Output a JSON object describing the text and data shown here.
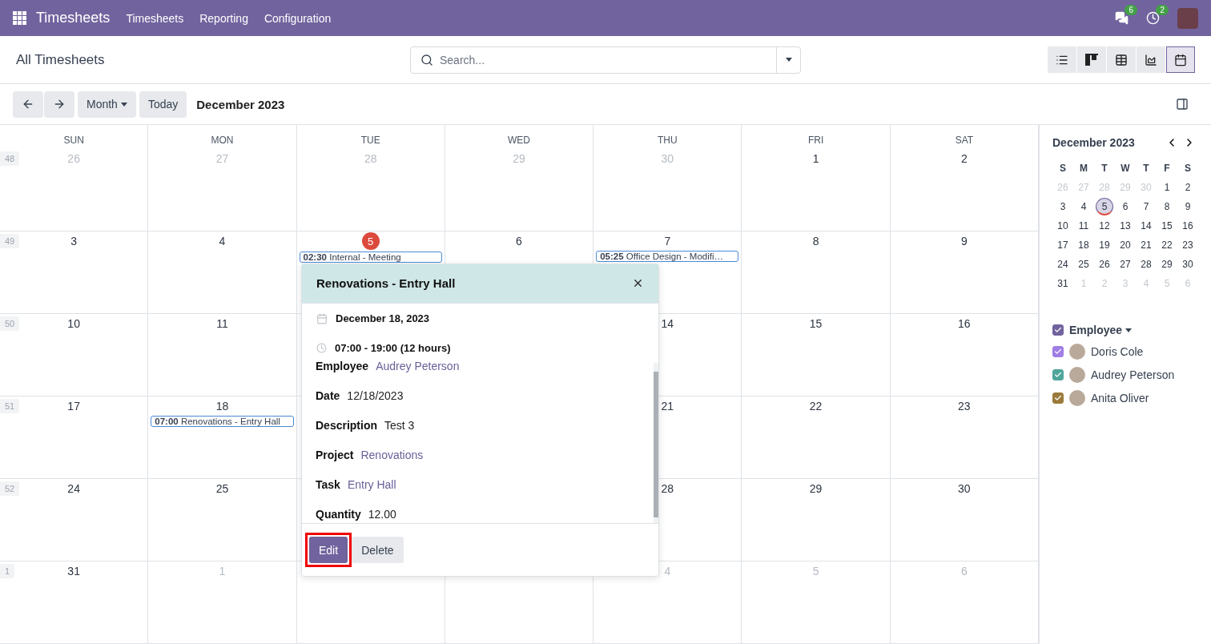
{
  "navbar": {
    "app_name": "Timesheets",
    "menu": [
      "Timesheets",
      "Reporting",
      "Configuration"
    ],
    "messages_count": "6",
    "activities_count": "2"
  },
  "control_panel": {
    "breadcrumb": "All Timesheets",
    "search": {
      "placeholder": "Search..."
    },
    "views": [
      {
        "kind": "list",
        "selected": false
      },
      {
        "kind": "kanban",
        "selected": false
      },
      {
        "kind": "pivot",
        "selected": false
      },
      {
        "kind": "graph",
        "selected": false
      },
      {
        "kind": "calendar",
        "selected": true
      }
    ]
  },
  "toolbar": {
    "scale": "Month",
    "today": "Today",
    "period": "December 2023"
  },
  "calendar": {
    "weekdays": [
      "SUN",
      "MON",
      "TUE",
      "WED",
      "THU",
      "FRI",
      "SAT"
    ],
    "weeks": [
      {
        "week": "48",
        "days": [
          {
            "day": "26",
            "other_month": true,
            "today": false
          },
          {
            "day": "27",
            "other_month": true,
            "today": false
          },
          {
            "day": "28",
            "other_month": true,
            "today": false
          },
          {
            "day": "29",
            "other_month": true,
            "today": false
          },
          {
            "day": "30",
            "other_month": true,
            "today": false
          },
          {
            "day": "1",
            "other_month": false,
            "today": false
          },
          {
            "day": "2",
            "other_month": false,
            "today": false
          }
        ]
      },
      {
        "week": "49",
        "days": [
          {
            "day": "3",
            "other_month": false,
            "today": false
          },
          {
            "day": "4",
            "other_month": false,
            "today": false
          },
          {
            "day": "5",
            "other_month": false,
            "today": true,
            "events": [
              {
                "time": "02:30",
                "title": "Internal - Meeting"
              }
            ]
          },
          {
            "day": "6",
            "other_month": false,
            "today": false
          },
          {
            "day": "7",
            "other_month": false,
            "today": false,
            "events": [
              {
                "time": "05:25",
                "title": "Office Design - Modifi…"
              }
            ]
          },
          {
            "day": "8",
            "other_month": false,
            "today": false
          },
          {
            "day": "9",
            "other_month": false,
            "today": false
          }
        ]
      },
      {
        "week": "50",
        "days": [
          {
            "day": "10",
            "other_month": false,
            "today": false
          },
          {
            "day": "11",
            "other_month": false,
            "today": false
          }
        ],
        "trailing_days": [
          {
            "day": "14",
            "other_month": false,
            "today": false
          },
          {
            "day": "15",
            "other_month": false,
            "today": false
          },
          {
            "day": "16",
            "other_month": false,
            "today": false
          }
        ]
      },
      {
        "week": "51",
        "days": [
          {
            "day": "17",
            "other_month": false,
            "today": false
          },
          {
            "day": "18",
            "other_month": false,
            "today": false,
            "events": [
              {
                "time": "07:00",
                "title": "Renovations - Entry Hall"
              }
            ]
          }
        ],
        "trailing_days": [
          {
            "day": "21",
            "other_month": false,
            "today": false
          },
          {
            "day": "22",
            "other_month": false,
            "today": false
          },
          {
            "day": "23",
            "other_month": false,
            "today": false
          }
        ]
      },
      {
        "week": "52",
        "days": [
          {
            "day": "24",
            "other_month": false,
            "today": false
          },
          {
            "day": "25",
            "other_month": false,
            "today": false
          }
        ],
        "trailing_days": [
          {
            "day": "28",
            "other_month": false,
            "today": false
          },
          {
            "day": "29",
            "other_month": false,
            "today": false
          },
          {
            "day": "30",
            "other_month": false,
            "today": false
          }
        ]
      },
      {
        "week": "1",
        "days": [
          {
            "day": "31",
            "other_month": false,
            "today": false
          },
          {
            "day": "1",
            "other_month": true,
            "today": false
          }
        ],
        "trailing_days": [
          {
            "day": "4",
            "other_month": true,
            "today": false
          },
          {
            "day": "5",
            "other_month": true,
            "today": false
          },
          {
            "day": "6",
            "other_month": true,
            "today": false
          }
        ]
      }
    ]
  },
  "popover": {
    "title": "Renovations - Entry Hall",
    "date": "December 18, 2023",
    "time": "07:00 - 19:00 (12 hours)",
    "fields": [
      {
        "label": "Employee",
        "value": "Audrey Peterson",
        "kind": "link"
      },
      {
        "label": "Date",
        "value": "12/18/2023",
        "kind": "text"
      },
      {
        "label": "Description",
        "value": "Test 3",
        "kind": "text"
      },
      {
        "label": "Project",
        "value": "Renovations",
        "kind": "link"
      },
      {
        "label": "Task",
        "value": "Entry Hall",
        "kind": "link"
      },
      {
        "label": "Quantity",
        "value": "12.00",
        "kind": "text"
      }
    ],
    "buttons": [
      {
        "label": "Edit",
        "kind": "primary",
        "highlighted": true
      },
      {
        "label": "Delete",
        "kind": "secondary",
        "highlighted": false
      }
    ]
  },
  "sidebar": {
    "mini_calendar": {
      "title": "December 2023",
      "weekdays": [
        "S",
        "M",
        "T",
        "W",
        "T",
        "F",
        "S"
      ],
      "weeks": [
        [
          {
            "day": "26",
            "other_month": true,
            "today": false
          },
          {
            "day": "27",
            "other_month": true,
            "today": false
          },
          {
            "day": "28",
            "other_month": true,
            "today": false
          },
          {
            "day": "29",
            "other_month": true,
            "today": false
          },
          {
            "day": "30",
            "other_month": true,
            "today": false
          },
          {
            "day": "1",
            "other_month": false,
            "today": false
          },
          {
            "day": "2",
            "other_month": false,
            "today": false
          }
        ],
        [
          {
            "day": "3",
            "other_month": false,
            "today": false
          },
          {
            "day": "4",
            "other_month": false,
            "today": false
          },
          {
            "day": "5",
            "other_month": false,
            "today": true
          },
          {
            "day": "6",
            "other_month": false,
            "today": false
          },
          {
            "day": "7",
            "other_month": false,
            "today": false
          },
          {
            "day": "8",
            "other_month": false,
            "today": false
          },
          {
            "day": "9",
            "other_month": false,
            "today": false
          }
        ],
        [
          {
            "day": "10",
            "other_month": false,
            "today": false
          },
          {
            "day": "11",
            "other_month": false,
            "today": false
          },
          {
            "day": "12",
            "other_month": false,
            "today": false
          },
          {
            "day": "13",
            "other_month": false,
            "today": false
          },
          {
            "day": "14",
            "other_month": false,
            "today": false
          },
          {
            "day": "15",
            "other_month": false,
            "today": false
          },
          {
            "day": "16",
            "other_month": false,
            "today": false
          }
        ],
        [
          {
            "day": "17",
            "other_month": false,
            "today": false
          },
          {
            "day": "18",
            "other_month": false,
            "today": false
          },
          {
            "day": "19",
            "other_month": false,
            "today": false
          },
          {
            "day": "20",
            "other_month": false,
            "today": false
          },
          {
            "day": "21",
            "other_month": false,
            "today": false
          },
          {
            "day": "22",
            "other_month": false,
            "today": false
          },
          {
            "day": "23",
            "other_month": false,
            "today": false
          }
        ],
        [
          {
            "day": "24",
            "other_month": false,
            "today": false
          },
          {
            "day": "25",
            "other_month": false,
            "today": false
          },
          {
            "day": "26",
            "other_month": false,
            "today": false
          },
          {
            "day": "27",
            "other_month": false,
            "today": false
          },
          {
            "day": "28",
            "other_month": false,
            "today": false
          },
          {
            "day": "29",
            "other_month": false,
            "today": false
          },
          {
            "day": "30",
            "other_month": false,
            "today": false
          }
        ],
        [
          {
            "day": "31",
            "other_month": false,
            "today": false
          },
          {
            "day": "1",
            "other_month": true,
            "today": false
          },
          {
            "day": "2",
            "other_month": true,
            "today": false
          },
          {
            "day": "3",
            "other_month": true,
            "today": false
          },
          {
            "day": "4",
            "other_month": true,
            "today": false
          },
          {
            "day": "5",
            "other_month": true,
            "today": false
          },
          {
            "day": "6",
            "other_month": true,
            "today": false
          }
        ]
      ]
    },
    "filter": {
      "title": "Employee",
      "checked": true,
      "color": "#71639e",
      "items": [
        {
          "name": "Doris Cole",
          "checked": true,
          "color": "#a07ee6"
        },
        {
          "name": "Audrey Peterson",
          "checked": true,
          "color": "#4fa59c"
        },
        {
          "name": "Anita Oliver",
          "checked": true,
          "color": "#9a7b3b"
        }
      ]
    }
  }
}
